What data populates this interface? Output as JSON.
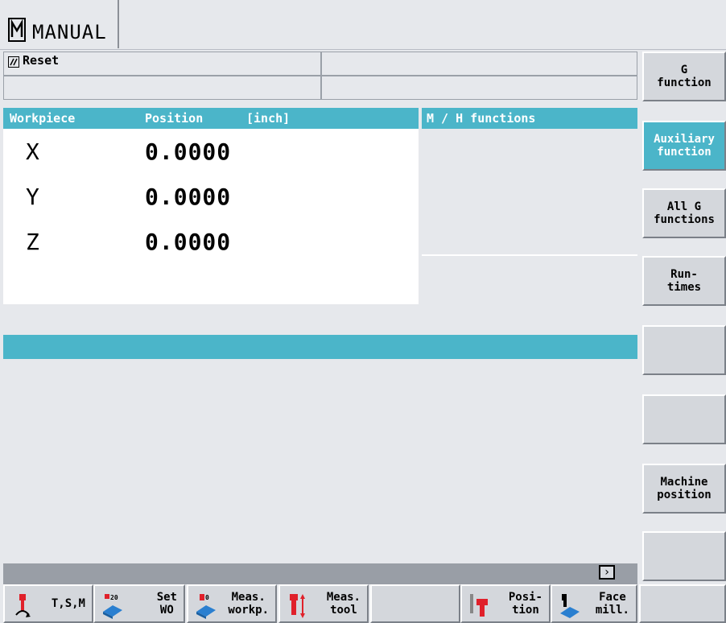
{
  "header": {
    "mode": "MANUAL",
    "mode_icon": "manual-mode-icon"
  },
  "status": {
    "reset_label": "Reset",
    "reset_icon": "reset-icon"
  },
  "workpiece": {
    "title": "Workpiece",
    "position_label": "Position",
    "unit_label": "[inch]",
    "axes": [
      {
        "name": "X",
        "value": "0.0000"
      },
      {
        "name": "Y",
        "value": "0.0000"
      },
      {
        "name": "Z",
        "value": "0.0000"
      }
    ]
  },
  "mh": {
    "title": "M / H functions"
  },
  "right_softkeys": [
    {
      "label": "G\nfunction",
      "active": false
    },
    {
      "label": "Auxiliary\nfunction",
      "active": true
    },
    {
      "label": "All G\nfunctions",
      "active": false
    },
    {
      "label": "Run-\ntimes",
      "active": false
    },
    {
      "label": "",
      "active": false
    },
    {
      "label": "",
      "active": false
    },
    {
      "label": "Machine\nposition",
      "active": false
    },
    {
      "label": "",
      "active": false
    }
  ],
  "bottom_softkeys": [
    {
      "label": "T,S,M",
      "icon": "tool-spindle-icon"
    },
    {
      "label": "Set\nWO",
      "icon": "set-work-offset-icon"
    },
    {
      "label": "Meas.\nworkp.",
      "icon": "measure-workpiece-icon"
    },
    {
      "label": "Meas.\ntool",
      "icon": "measure-tool-icon"
    },
    {
      "label": "",
      "icon": ""
    },
    {
      "label": "Posi-\ntion",
      "icon": "position-icon"
    },
    {
      "label": "Face\nmill.",
      "icon": "face-milling-icon"
    },
    {
      "label": "",
      "icon": ""
    }
  ],
  "colors": {
    "accent": "#4bb5c9",
    "background": "#e6e8ec",
    "tool_red": "#e0202a",
    "work_blue": "#2a7fd0"
  }
}
